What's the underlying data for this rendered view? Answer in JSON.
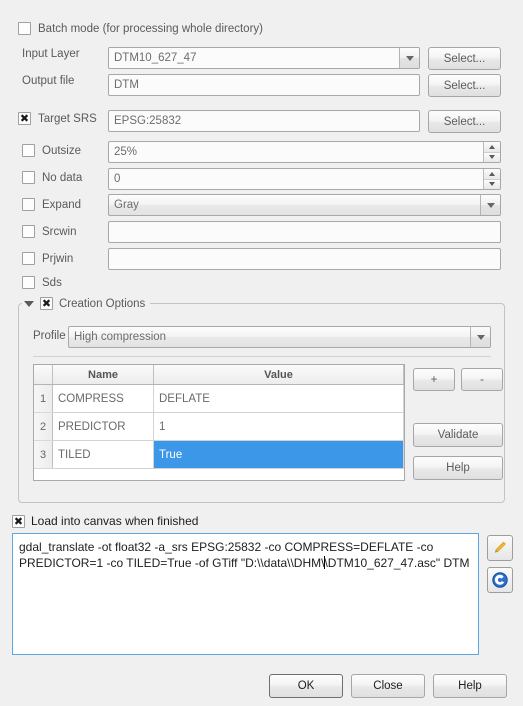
{
  "dialog": {
    "batch_mode": {
      "label": "Batch mode (for processing whole directory)",
      "checked": false
    }
  },
  "form": {
    "input_layer": {
      "label": "Input Layer",
      "value": "DTM10_627_47",
      "button": "Select..."
    },
    "output_file": {
      "label": "Output file",
      "value": "DTM",
      "button": "Select..."
    },
    "target_srs": {
      "label": "Target SRS",
      "value": "EPSG:25832",
      "button": "Select...",
      "checked": true
    },
    "outsize": {
      "label": "Outsize",
      "value": "25%",
      "checked": false
    },
    "no_data": {
      "label": "No data",
      "value": "0",
      "checked": false
    },
    "expand": {
      "label": "Expand",
      "value": "Gray",
      "checked": false
    },
    "srcwin": {
      "label": "Srcwin",
      "value": "",
      "checked": false
    },
    "prjwin": {
      "label": "Prjwin",
      "value": "",
      "checked": false
    },
    "sds": {
      "label": "Sds",
      "checked": false
    }
  },
  "creation_options": {
    "title": "Creation Options",
    "checked": true,
    "expanded": true,
    "profile_label": "Profile",
    "profile_value": "High compression",
    "columns": [
      "",
      "Name",
      "Value"
    ],
    "rows": [
      {
        "num": "1",
        "name": "COMPRESS",
        "value": "DEFLATE",
        "selected": false
      },
      {
        "num": "2",
        "name": "PREDICTOR",
        "value": "1",
        "selected": false
      },
      {
        "num": "3",
        "name": "TILED",
        "value": "True",
        "selected": true
      }
    ],
    "add_button": "+",
    "remove_button": "-",
    "validate_button": "Validate",
    "help_button": "Help",
    "selection_color": "#3d97e8"
  },
  "command": {
    "load_into_canvas": {
      "label": "Load into canvas when finished",
      "checked": true
    },
    "text_before_caret": "gdal_translate -ot float32 -a_srs EPSG:25832 -co COMPRESS=DEFLATE -co PREDICTOR=1 -co TILED=True -of GTiff \"D:\\\\data\\\\DHM\\",
    "text_after_caret": "\\DTM10_627_47.asc\" DTM",
    "full_text": "gdal_translate -ot float32 -a_srs EPSG:25832 -co COMPRESS=DEFLATE -co PREDICTOR=1 -co TILED=True -of GTiff \"D:\\\\data\\\\DHM\\\\DTM10_627_47.asc\" DTM",
    "edit_icon": "pencil-icon",
    "gdal_icon": "gdal-globe-icon"
  },
  "footer": {
    "ok": "OK",
    "close": "Close",
    "help": "Help"
  }
}
